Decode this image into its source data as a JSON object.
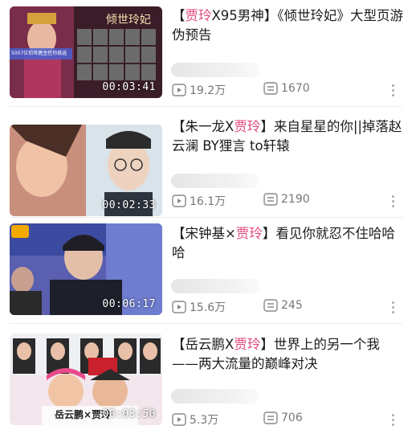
{
  "videos": [
    {
      "title_open": "【",
      "title_hl": "贾玲",
      "title_rest": "X95男神】《倾世玲妃》大型页游伪预告",
      "duration": "00:03:41",
      "views": "19.2万",
      "comments": "1670"
    },
    {
      "title_open": "【朱一龙X",
      "title_hl": "贾玲",
      "title_rest": "】来自星星的你||掉落赵云澜 BY狸言 to轩辕",
      "duration": "00:02:33",
      "views": "16.1万",
      "comments": "2190"
    },
    {
      "title_open": "【宋钟基×",
      "title_hl": "贾玲",
      "title_rest": "】看见你就忍不住哈哈哈",
      "duration": "00:06:17",
      "views": "15.6万",
      "comments": "245"
    },
    {
      "title_open": "【岳云鹏X",
      "title_hl": "贾玲",
      "title_rest": "】世界上的另一个我——两大流量的巅峰对决",
      "duration": "00:03:50",
      "views": "5.3万",
      "comments": "706"
    }
  ],
  "thumb_texts": {
    "t1_banner": "倾世玲妃",
    "t1_side": "5007位前世男主任你挑选",
    "t4_caption": "岳云鹏×贾玲"
  },
  "colors": {
    "highlight": "#e5477a",
    "meta": "#777777",
    "background": "#ffffff"
  },
  "icons": {
    "views": "play-count-icon",
    "comments": "danmaku-icon",
    "more": "more-vertical-icon"
  }
}
